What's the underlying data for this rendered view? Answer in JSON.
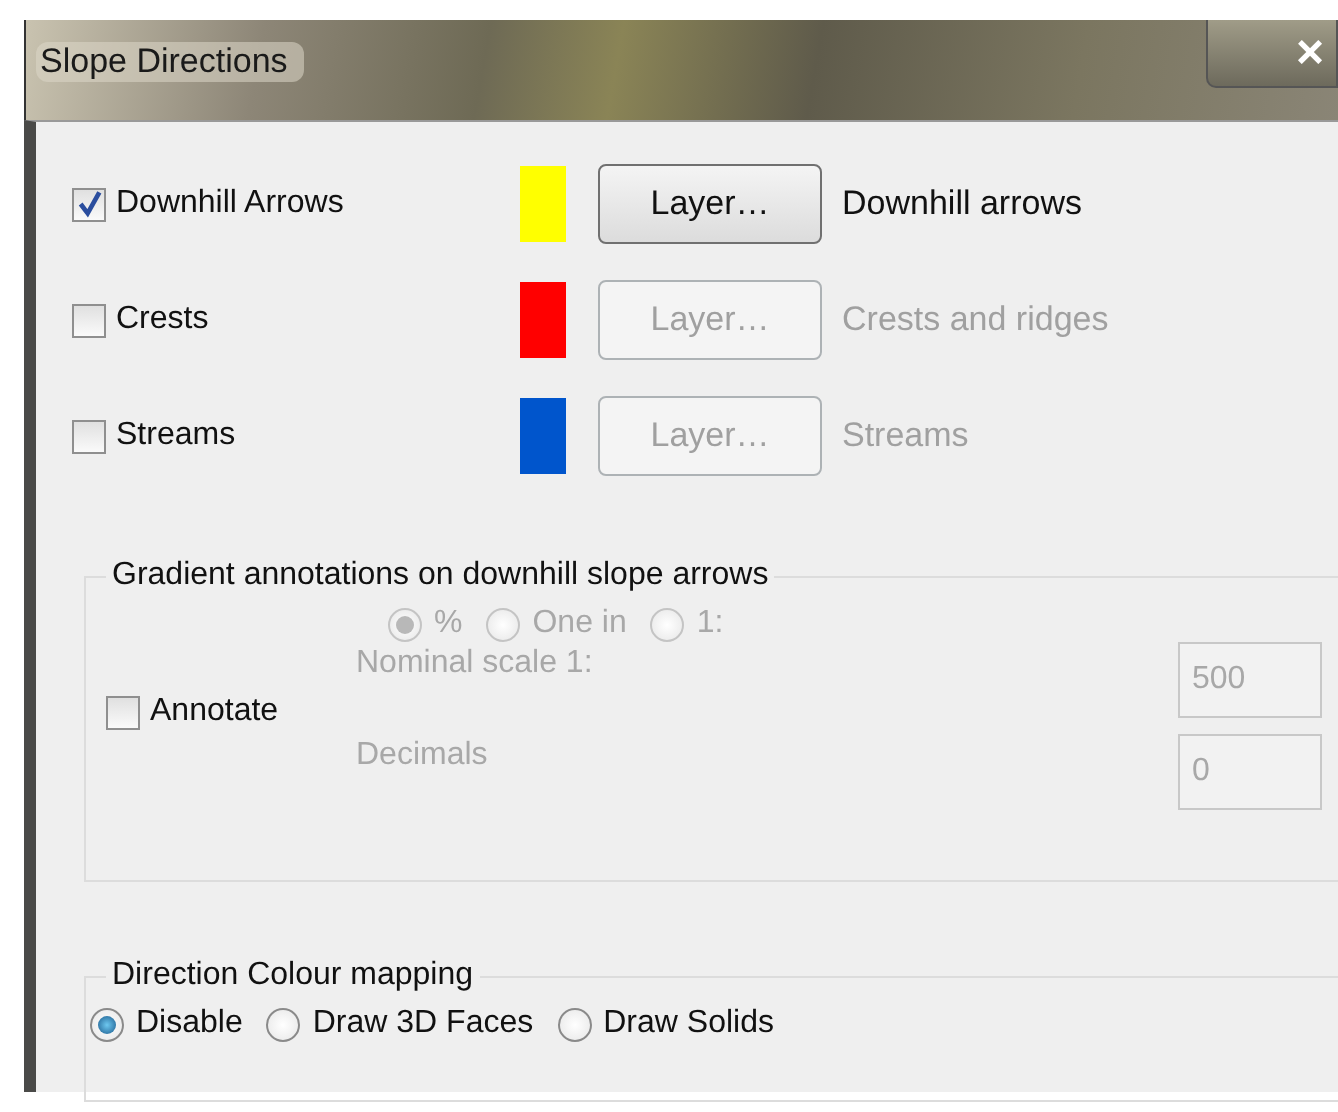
{
  "window": {
    "title": "Slope Directions",
    "close": "×"
  },
  "layers": [
    {
      "label": "Downhill Arrows",
      "checked": true,
      "color": "#ffff00",
      "button": "Layer…",
      "description": "Downhill arrows"
    },
    {
      "label": "Crests",
      "checked": false,
      "color": "#ff0000",
      "button": "Layer…",
      "description": "Crests and ridges"
    },
    {
      "label": "Streams",
      "checked": false,
      "color": "#0055cc",
      "button": "Layer…",
      "description": "Streams"
    }
  ],
  "gradient_group": {
    "legend": "Gradient annotations on downhill slope arrows",
    "annotate": {
      "label": "Annotate",
      "checked": false
    },
    "units": [
      {
        "label": "%",
        "selected": true
      },
      {
        "label": "One in",
        "selected": false
      },
      {
        "label": "1:",
        "selected": false
      }
    ],
    "fields": [
      {
        "label": "Nominal scale 1:",
        "value": "500"
      },
      {
        "label": "Decimals",
        "value": "0"
      }
    ]
  },
  "colour_group": {
    "legend": "Direction Colour mapping",
    "options": [
      {
        "label": "Disable",
        "selected": true
      },
      {
        "label": "Draw 3D Faces",
        "selected": false
      },
      {
        "label": "Draw Solids",
        "selected": false
      }
    ]
  }
}
